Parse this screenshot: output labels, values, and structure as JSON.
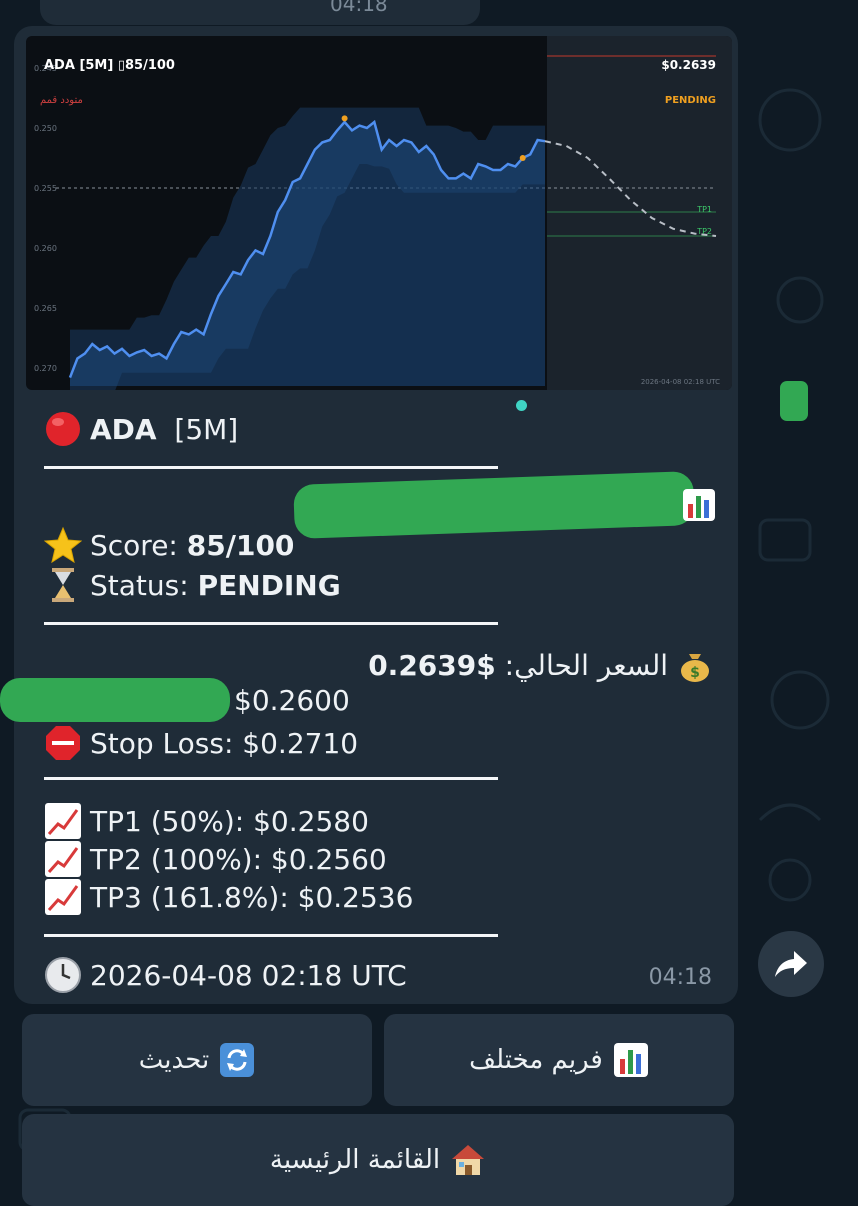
{
  "top": {
    "prev_time": "04:18"
  },
  "chart": {
    "symbol_label": "ADA  [5M]  ▯85/100",
    "arabic_tag": "متودد قمم",
    "price_label": "$0.2639",
    "status_label": "PENDING",
    "tp1_label": "TP1",
    "tp2_label": "TP2",
    "footer_ts": "2026-04-08 02:18 UTC",
    "y_ticks": [
      "0.270",
      "0.265",
      "0.260",
      "0.255",
      "0.250",
      "0.245"
    ]
  },
  "chart_data": {
    "type": "line",
    "title": "ADA  [5M]  85/100",
    "ylim": [
      0.2435,
      0.271
    ],
    "y_ticks": [
      0.245,
      0.25,
      0.255,
      0.26,
      0.265,
      0.27
    ],
    "series": [
      {
        "values": [
          0.2442,
          0.2458,
          0.2462,
          0.247,
          0.2465,
          0.2468,
          0.2462,
          0.2466,
          0.246,
          0.2463,
          0.2465,
          0.246,
          0.2462,
          0.2458,
          0.247,
          0.248,
          0.2478,
          0.2482,
          0.2478,
          0.2495,
          0.251,
          0.252,
          0.253,
          0.2528,
          0.254,
          0.2548,
          0.2545,
          0.256,
          0.258,
          0.259,
          0.2605,
          0.2608,
          0.262,
          0.2632,
          0.2638,
          0.264,
          0.2648,
          0.2655,
          0.2648,
          0.2652,
          0.265,
          0.2655,
          0.2632,
          0.264,
          0.2635,
          0.264,
          0.2638,
          0.263,
          0.2635,
          0.2628,
          0.2615,
          0.2608,
          0.2608,
          0.2612,
          0.2608,
          0.262,
          0.2618,
          0.2615,
          0.2615,
          0.262,
          0.2618,
          0.2625,
          0.2628,
          0.264,
          0.2639
        ]
      }
    ],
    "forecast": [
      0.2639,
      0.2635,
      0.2625,
      0.2608,
      0.259,
      0.2575,
      0.2566,
      0.2562,
      0.256
    ],
    "levels": {
      "current": 0.2639,
      "entry": 0.26,
      "stop_loss": 0.271,
      "tp1": 0.258,
      "tp2": 0.256
    },
    "pivots": [
      0.2658,
      0.2625
    ]
  },
  "message": {
    "title_symbol": "ADA",
    "title_tf": "[5M]",
    "score_label": "Score: ",
    "score_value": "85/100",
    "status_label": "Status: ",
    "status_value": "PENDING",
    "current_price_label": "السعر الحالي: ",
    "current_price_value": "0.2639$",
    "entry_value": "$0.2600",
    "stop_loss_text": "Stop Loss: $0.2710",
    "tp1_text": "TP1 (50%):    $0.2580",
    "tp2_text": "TP2 (100%):   $0.2560",
    "tp3_text": "TP3 (161.8%): $0.2536",
    "timestamp": "2026-04-08 02:18 UTC",
    "time": "04:18"
  },
  "keyboard": {
    "refresh": "تحديث",
    "different_frame": "فريم مختلف",
    "main_menu": "القائمة الرئيسية"
  },
  "colors": {
    "price_line": "#4f8ff0",
    "accent_green": "#32a853",
    "pending_orange": "#f0a020"
  }
}
